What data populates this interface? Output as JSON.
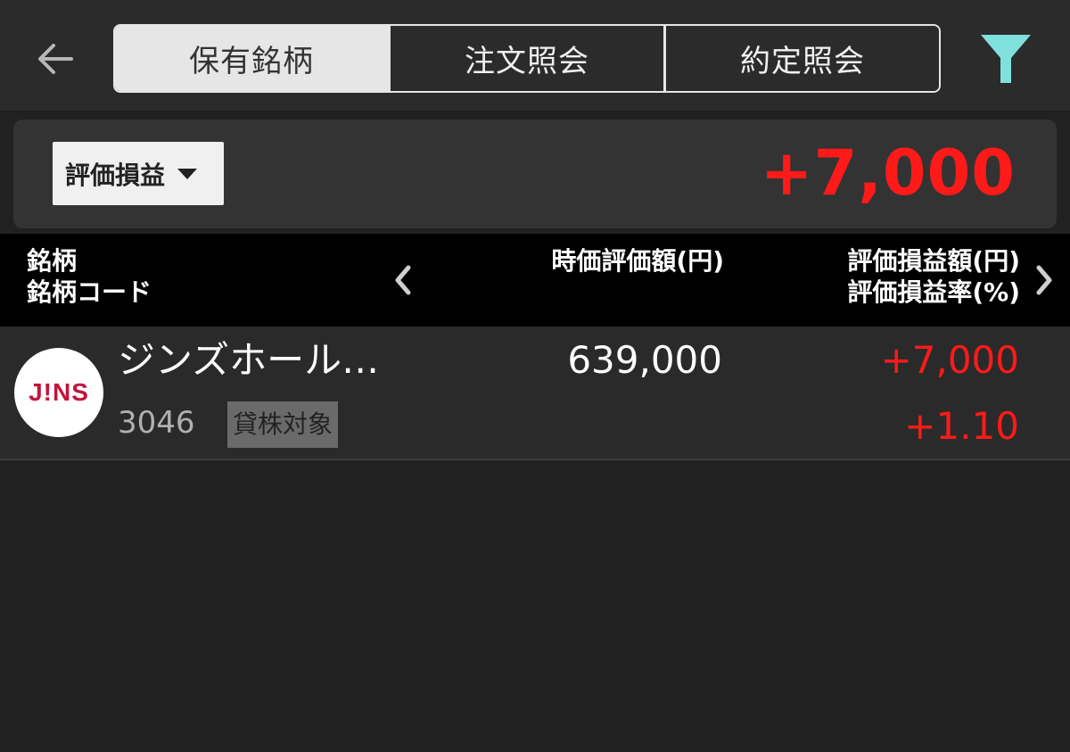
{
  "tabs": [
    {
      "label": "保有銘柄",
      "active": true
    },
    {
      "label": "注文照会",
      "active": false
    },
    {
      "label": "約定照会",
      "active": false
    }
  ],
  "icons": {
    "back": "arrow-left-icon",
    "filter": "funnel-icon",
    "prev": "chevron-left-icon",
    "next": "chevron-right-icon"
  },
  "summary": {
    "metric_label": "評価損益",
    "value": "+7,000"
  },
  "header": {
    "col1_line1": "銘柄",
    "col1_line2": "銘柄コード",
    "col2": "時価評価額(円)",
    "col3_line1": "評価損益額(円)",
    "col3_line2": "評価損益率(%)"
  },
  "holdings": [
    {
      "logo_text": "J!NS",
      "name": "ジンズホール…",
      "code": "3046",
      "badge": "貸株対象",
      "market_value": "639,000",
      "pl_amount": "+7,000",
      "pl_rate": "+1.10"
    }
  ],
  "colors": {
    "accent_filter": "#7fe0dc",
    "positive": "#ff1a1a",
    "background": "#212121"
  }
}
